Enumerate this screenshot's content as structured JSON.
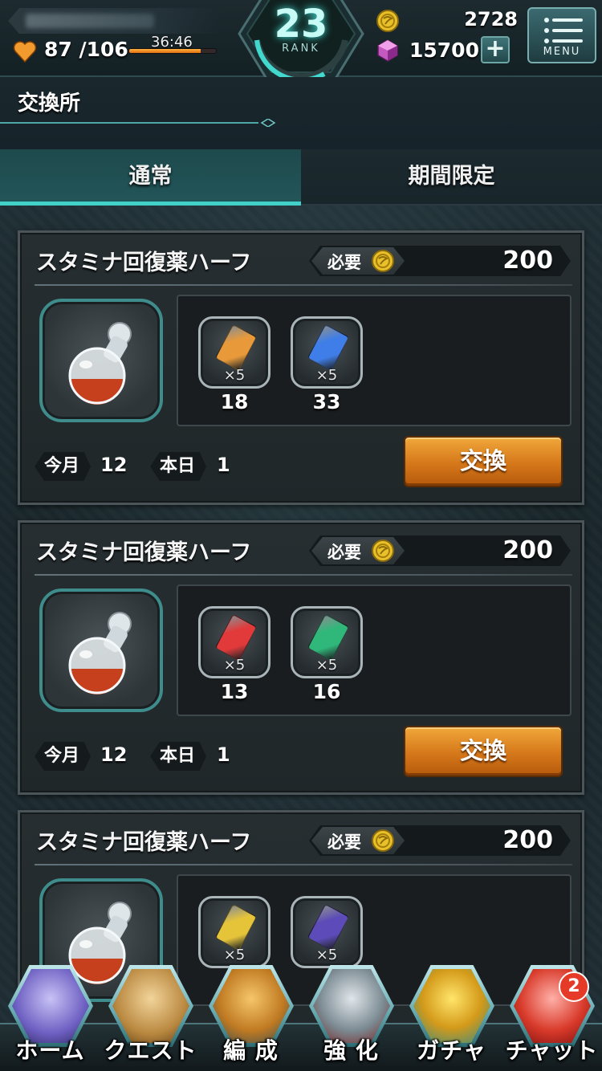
{
  "header": {
    "stamina": {
      "current": 87,
      "max": 106,
      "text": "87 /106",
      "timer": "36:46",
      "fill_fraction": 0.82
    },
    "rank": {
      "value": "23",
      "label": "RANK"
    },
    "coins": "2728",
    "gems": "15700",
    "plus_label": "+",
    "menu_label": "MENU"
  },
  "page": {
    "title": "交換所"
  },
  "tabs": [
    {
      "label": "通常",
      "active": true
    },
    {
      "label": "期間限定",
      "active": false
    }
  ],
  "cards": [
    {
      "name": "スタミナ回復薬ハーフ",
      "required_label": "必要",
      "required_value": "200",
      "materials": [
        {
          "color": "orange",
          "mult": "×5",
          "count": "18"
        },
        {
          "color": "blue",
          "mult": "×5",
          "count": "33"
        }
      ],
      "month_label": "今月",
      "month_value": "12",
      "day_label": "本日",
      "day_value": "1",
      "button_label": "交換"
    },
    {
      "name": "スタミナ回復薬ハーフ",
      "required_label": "必要",
      "required_value": "200",
      "materials": [
        {
          "color": "red",
          "mult": "×5",
          "count": "13"
        },
        {
          "color": "green",
          "mult": "×5",
          "count": "16"
        }
      ],
      "month_label": "今月",
      "month_value": "12",
      "day_label": "本日",
      "day_value": "1",
      "button_label": "交換"
    },
    {
      "name": "スタミナ回復薬ハーフ",
      "required_label": "必要",
      "required_value": "200",
      "materials": [
        {
          "color": "yellow",
          "mult": "×5",
          "count": ""
        },
        {
          "color": "purple",
          "mult": "×5",
          "count": ""
        }
      ],
      "month_label": "",
      "month_value": "",
      "day_label": "",
      "day_value": "",
      "button_label": ""
    }
  ],
  "colors": {
    "orange": "#e89a3a",
    "blue": "#3f7ee8",
    "red": "#e23a3a",
    "green": "#2fb87a",
    "yellow": "#e6c43a",
    "purple": "#5c4bb8",
    "accent": "#41d1c8",
    "button": "#d5771a"
  },
  "bottom_nav": [
    {
      "label": "ホーム",
      "icon": "crystal-tower-icon"
    },
    {
      "label": "クエスト",
      "icon": "map-icon"
    },
    {
      "label": "編 成",
      "icon": "party-icon"
    },
    {
      "label": "強 化",
      "icon": "sword-shield-icon"
    },
    {
      "label": "ガチャ",
      "icon": "gacha-crystal-icon"
    },
    {
      "label": "チャット",
      "icon": "chat-icon",
      "badge": "2"
    }
  ]
}
